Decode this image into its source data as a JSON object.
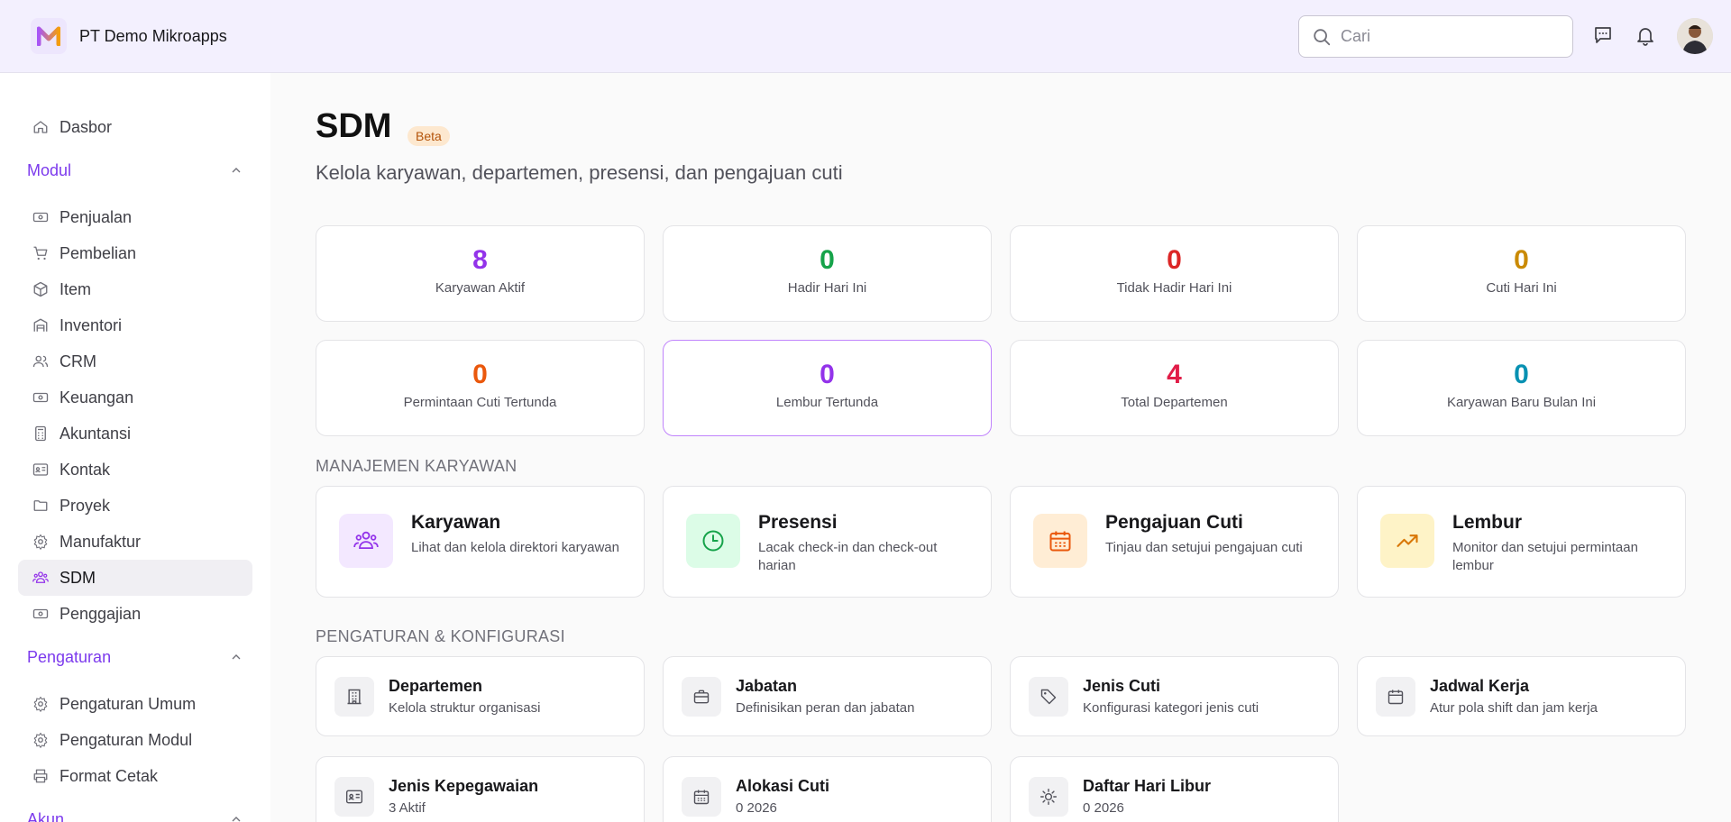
{
  "header": {
    "company": "PT Demo Mikroapps",
    "search_placeholder": "Cari"
  },
  "sidebar": {
    "top": [
      {
        "label": "Dasbor",
        "icon": "home-icon"
      }
    ],
    "modul_label": "Modul",
    "modul_items": [
      {
        "label": "Penjualan",
        "icon": "banknote-icon"
      },
      {
        "label": "Pembelian",
        "icon": "cart-icon"
      },
      {
        "label": "Item",
        "icon": "box-icon"
      },
      {
        "label": "Inventori",
        "icon": "warehouse-icon"
      },
      {
        "label": "CRM",
        "icon": "users-icon"
      },
      {
        "label": "Keuangan",
        "icon": "banknote-icon"
      },
      {
        "label": "Akuntansi",
        "icon": "calculator-icon"
      },
      {
        "label": "Kontak",
        "icon": "contact-card-icon"
      },
      {
        "label": "Proyek",
        "icon": "folder-icon"
      },
      {
        "label": "Manufaktur",
        "icon": "gear-icon"
      },
      {
        "label": "SDM",
        "icon": "team-icon",
        "active": true
      },
      {
        "label": "Penggajian",
        "icon": "banknote-icon"
      }
    ],
    "pengaturan_label": "Pengaturan",
    "pengaturan_items": [
      {
        "label": "Pengaturan Umum",
        "icon": "gear-icon"
      },
      {
        "label": "Pengaturan Modul",
        "icon": "gear-icon"
      },
      {
        "label": "Format Cetak",
        "icon": "printer-icon"
      }
    ],
    "akun_label": "Akun"
  },
  "page": {
    "title": "SDM",
    "badge": "Beta",
    "subtitle": "Kelola karyawan, departemen, presensi, dan pengajuan cuti"
  },
  "stats": [
    {
      "value": "8",
      "label": "Karyawan Aktif",
      "color": "#9333ea"
    },
    {
      "value": "0",
      "label": "Hadir Hari Ini",
      "color": "#16a34a"
    },
    {
      "value": "0",
      "label": "Tidak Hadir Hari Ini",
      "color": "#dc2626"
    },
    {
      "value": "0",
      "label": "Cuti Hari Ini",
      "color": "#ca8a04"
    },
    {
      "value": "0",
      "label": "Permintaan Cuti Tertunda",
      "color": "#ea580c"
    },
    {
      "value": "0",
      "label": "Lembur Tertunda",
      "color": "#9333ea"
    },
    {
      "value": "4",
      "label": "Total Departemen",
      "color": "#e11d48"
    },
    {
      "value": "0",
      "label": "Karyawan Baru Bulan Ini",
      "color": "#0891b2"
    }
  ],
  "sections": {
    "management": "MANAJEMEN KARYAWAN",
    "config": "PENGATURAN & KONFIGURASI"
  },
  "management_cards": [
    {
      "title": "Karyawan",
      "desc": "Lihat dan kelola direktori karyawan",
      "icon": "team-icon",
      "bg": "#f3e8ff",
      "fg": "#9333ea"
    },
    {
      "title": "Presensi",
      "desc": "Lacak check-in dan check-out harian",
      "icon": "clock-icon",
      "bg": "#dcfce7",
      "fg": "#16a34a"
    },
    {
      "title": "Pengajuan Cuti",
      "desc": "Tinjau dan setujui pengajuan cuti",
      "icon": "calendar-icon",
      "bg": "#ffedd5",
      "fg": "#ea580c"
    },
    {
      "title": "Lembur",
      "desc": "Monitor dan setujui permintaan lembur",
      "icon": "trending-up-icon",
      "bg": "#fef3c7",
      "fg": "#d97706"
    }
  ],
  "config_cards": [
    {
      "title": "Departemen",
      "desc": "Kelola struktur organisasi",
      "icon": "building-icon"
    },
    {
      "title": "Jabatan",
      "desc": "Definisikan peran dan jabatan",
      "icon": "briefcase-icon"
    },
    {
      "title": "Jenis Cuti",
      "desc": "Konfigurasi kategori jenis cuti",
      "icon": "tag-icon"
    },
    {
      "title": "Jadwal Kerja",
      "desc": "Atur pola shift dan jam kerja",
      "icon": "calendar-icon"
    },
    {
      "title": "Jenis Kepegawaian",
      "desc": "3 Aktif",
      "icon": "id-card-icon"
    },
    {
      "title": "Alokasi Cuti",
      "desc": "0 2026",
      "icon": "calendar-grid-icon"
    },
    {
      "title": "Daftar Hari Libur",
      "desc": "0 2026",
      "icon": "sun-icon"
    }
  ]
}
